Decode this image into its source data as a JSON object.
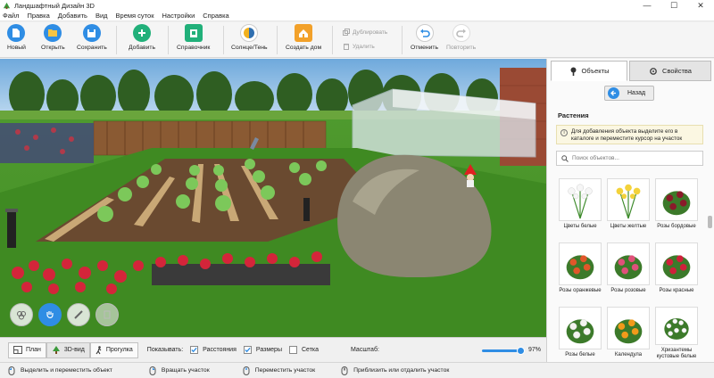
{
  "window": {
    "title": "Ландшафтный Дизайн 3D",
    "controls": [
      "—",
      "☐",
      "✕"
    ]
  },
  "menu": [
    "Файл",
    "Правка",
    "Добавить",
    "Вид",
    "Время суток",
    "Настройки",
    "Справка"
  ],
  "toolbar": {
    "new": "Новый",
    "open": "Открыть",
    "save": "Сохранить",
    "add": "Добавить",
    "reference": "Справочник",
    "sun_shadow": "Солнце/Тень",
    "create_house": "Создать дом",
    "duplicate": "Дублировать",
    "delete": "Удалить",
    "undo": "Отменить",
    "redo": "Повторить"
  },
  "modes": {
    "plan": "План",
    "view3d": "3D-вид",
    "walk": "Прогулка"
  },
  "show": {
    "label": "Показывать:",
    "distances": "Расстояния",
    "sizes": "Размеры",
    "grid": "Сетка",
    "distances_checked": true,
    "sizes_checked": true,
    "grid_checked": false
  },
  "scale": {
    "label": "Масштаб:",
    "value": "97%",
    "fraction": 0.97
  },
  "hints": {
    "select": "Выделить и переместить объект",
    "rotate": "Вращать участок",
    "move": "Переместить участок",
    "zoom": "Приблизить или отдалить участок"
  },
  "panel": {
    "tab_objects": "Объекты",
    "tab_properties": "Свойства",
    "back": "Назад",
    "section": "Растения",
    "note": "Для добавления объекта выделите его в каталоге и переместите курсор на участок",
    "search_placeholder": "Поиск объектов...",
    "items": [
      {
        "name": "Цветы белые"
      },
      {
        "name": "Цветы желтые"
      },
      {
        "name": "Розы бордовые"
      },
      {
        "name": "Розы оранжевые"
      },
      {
        "name": "Розы розовые"
      },
      {
        "name": "Розы красные"
      },
      {
        "name": "Розы белые"
      },
      {
        "name": "Календула"
      },
      {
        "name": "Хризантемы кустовые белые"
      }
    ]
  },
  "colors": {
    "accent": "#2f8de4",
    "add_green": "#21b07a",
    "house_orange": "#f2a12a"
  }
}
